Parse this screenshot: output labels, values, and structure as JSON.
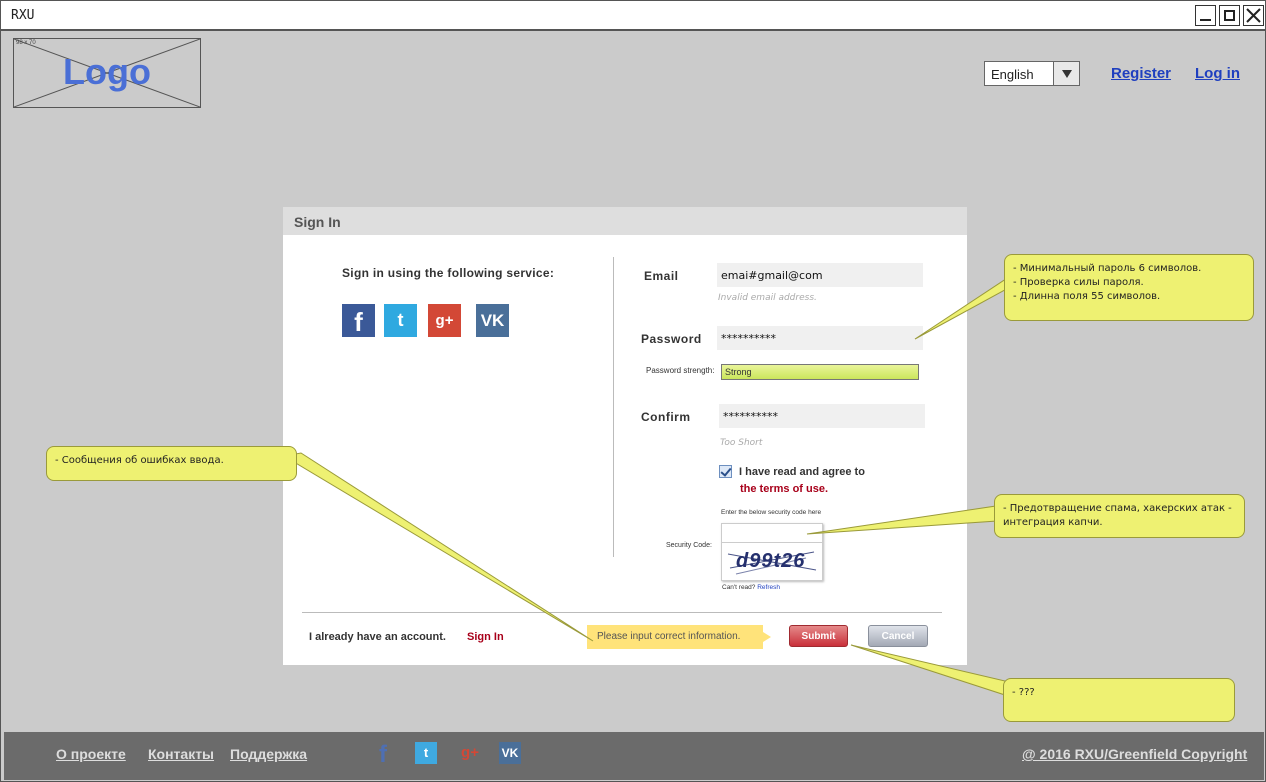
{
  "window": {
    "title": "RXU"
  },
  "logo": {
    "label": "Logo",
    "size_hint": "98 x 70"
  },
  "header": {
    "language": {
      "selected": "English"
    },
    "register_label": "Register",
    "login_label": "Log in"
  },
  "dialog": {
    "title": "Sign In",
    "services_label": "Sign in using the following service:",
    "services": [
      {
        "name": "facebook",
        "glyph": "f"
      },
      {
        "name": "twitter",
        "glyph": "t"
      },
      {
        "name": "google-plus",
        "glyph": "g+"
      },
      {
        "name": "vk",
        "glyph": "VK"
      }
    ],
    "email": {
      "label": "Email",
      "value": "emai#gmail@com",
      "error": "Invalid email address."
    },
    "password": {
      "label": "Password",
      "value": "**********",
      "strength_label": "Password strength:",
      "strength_value": "Strong"
    },
    "confirm": {
      "label": "Confirm",
      "value": "**********",
      "error": "Too Short"
    },
    "agree": {
      "text": "I have read and agree to",
      "terms": "the terms of use.",
      "checked": true
    },
    "security": {
      "hint": "Enter the below security code here",
      "label": "Security Code:",
      "captcha": "d99t26",
      "cant_read": "Can't read?",
      "refresh": "Refresh"
    },
    "footer": {
      "have_account": "I already have an account.",
      "sign_in": "Sign In",
      "error_tip": "Please input correct information.",
      "submit": "Submit",
      "cancel": "Cancel"
    }
  },
  "notes": {
    "password": [
      "- Минимальный пароль 6 символов.",
      "- Проверка силы пароля.",
      "- Длинна поля 55 символов."
    ],
    "errors": [
      "- Сообщения об ошибках ввода."
    ],
    "captcha": [
      "- Предотвращение спама, хакерских атак -",
      "интеграция капчи."
    ],
    "submit": [
      "- ???"
    ]
  },
  "footer": {
    "links": [
      "О проекте",
      "Контакты",
      "Поддержка"
    ],
    "icons": [
      "f",
      "t",
      "g+",
      "VK"
    ],
    "copyright": "@ 2016 RXU/Greenfield Copyright"
  },
  "colors": {
    "accent_link": "#1f3fbf",
    "brand_red": "#a8001a",
    "note_bg": "#eef172",
    "footer_bg": "#6b6b6b"
  }
}
